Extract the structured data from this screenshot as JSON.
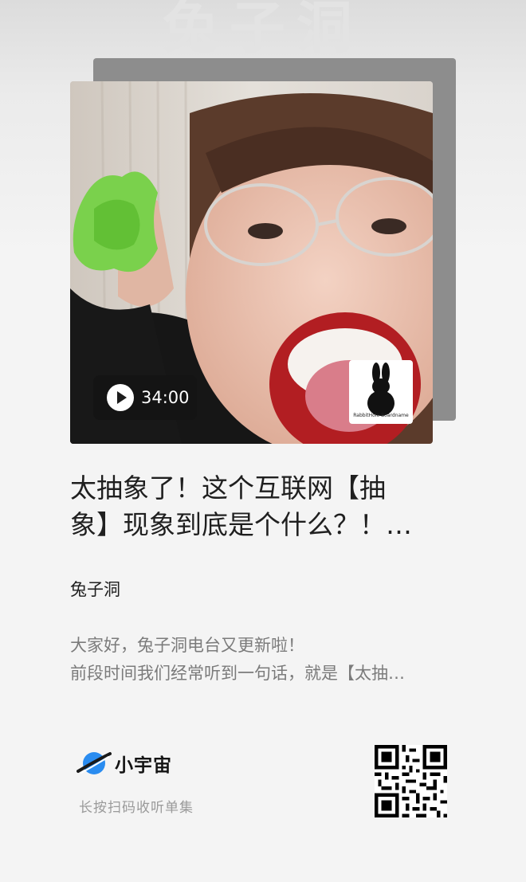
{
  "watermark": "兔子洞",
  "cover": {
    "duration": "34:00",
    "badge_text": "RabbitHole Boardname",
    "badge_icon": "rabbit-silhouette"
  },
  "episode": {
    "title_line1": "太抽象了！这个互联网【抽",
    "title_line2": "象】现象到底是个什么？！…",
    "channel": "兔子洞",
    "desc_line1": "大家好，兔子洞电台又更新啦！",
    "desc_line2": "前段时间我们经常听到一句话，就是【太抽…"
  },
  "footer": {
    "app_name": "小宇宙",
    "hint": "长按扫码收听单集",
    "logo_icon": "planet-logo",
    "qr_icon": "qr-code"
  },
  "colors": {
    "logo_blue": "#2a8cf0",
    "title": "#1f1f1f",
    "desc": "#7b7b7b",
    "hint": "#9a9a9a"
  }
}
